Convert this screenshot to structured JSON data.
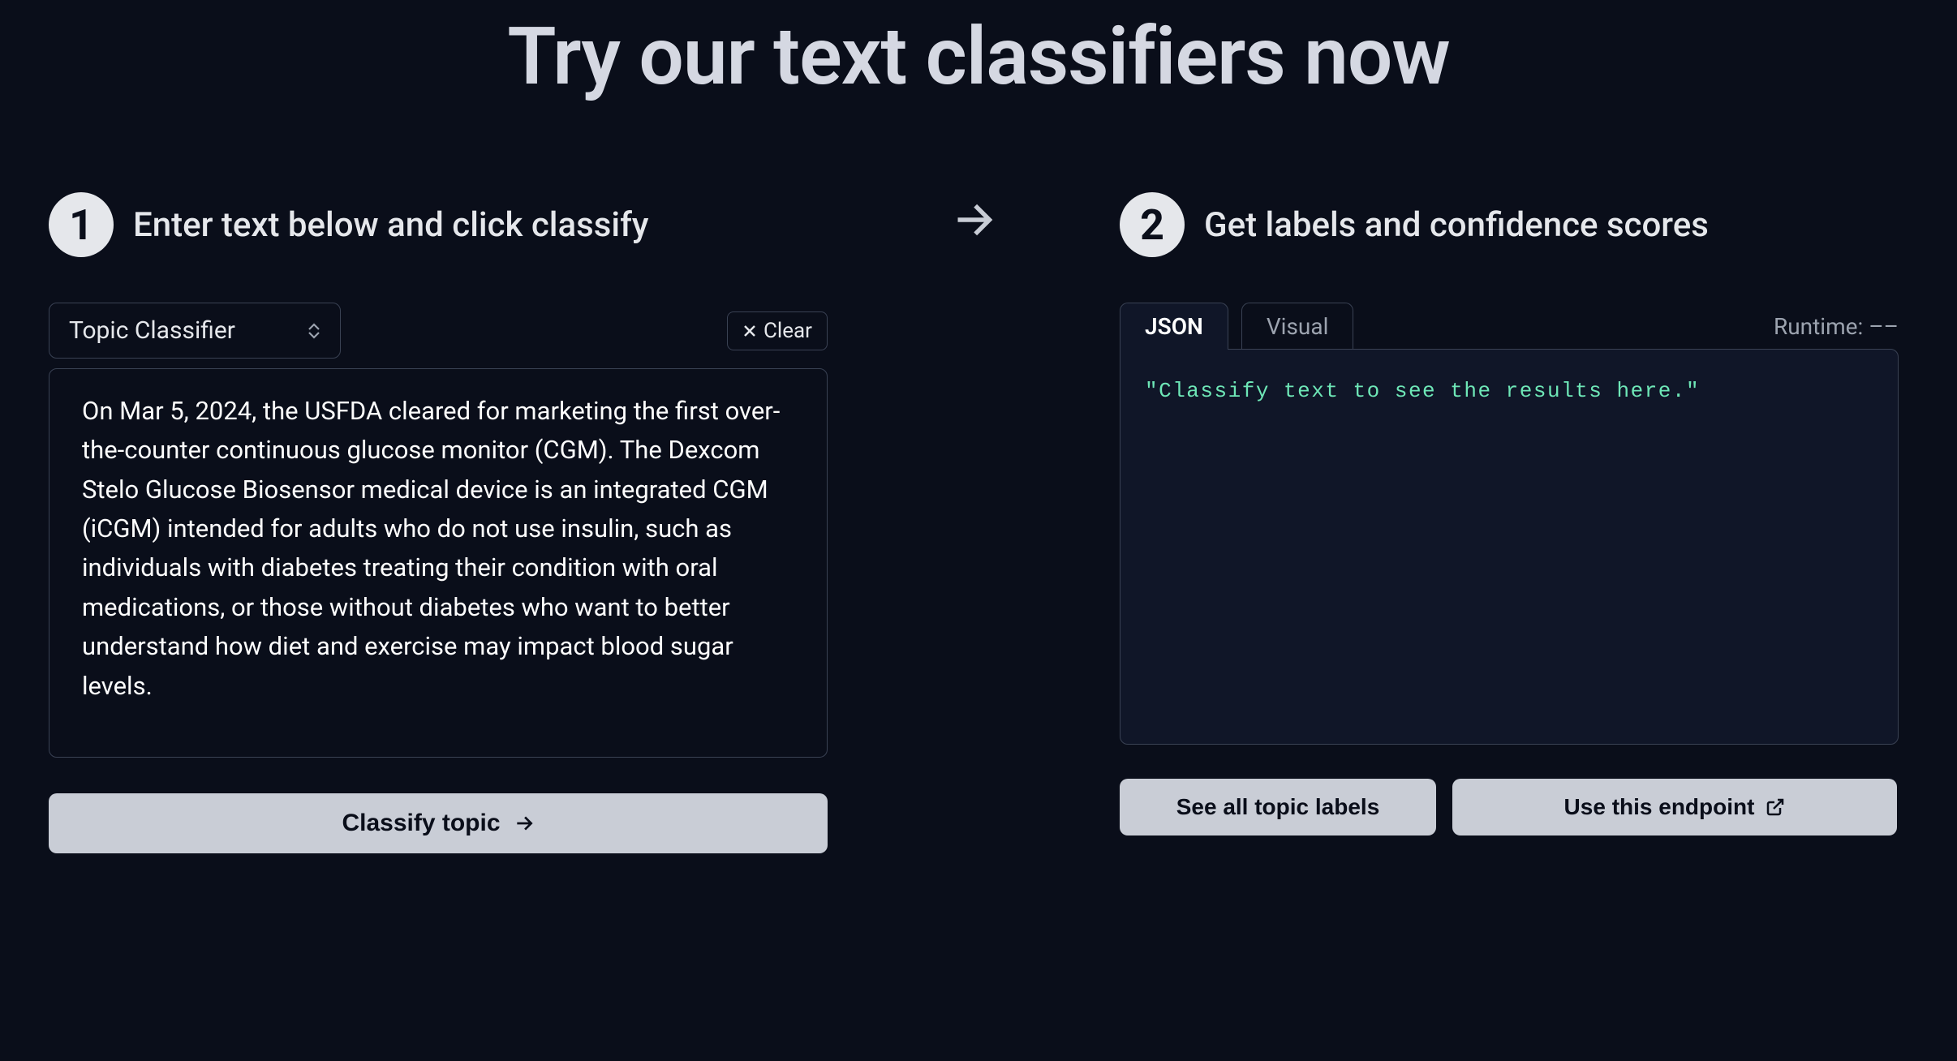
{
  "title": "Try our text classifiers now",
  "steps": {
    "one": {
      "num": "1",
      "title": "Enter text below and click classify"
    },
    "two": {
      "num": "2",
      "title": "Get labels and confidence scores"
    }
  },
  "left": {
    "classifier_select": "Topic Classifier",
    "clear_label": "Clear",
    "text_value": "On Mar 5, 2024, the USFDA cleared for marketing the first over-the-counter continuous glucose monitor (CGM). The Dexcom Stelo Glucose Biosensor medical device is an integrated CGM (iCGM) intended for adults who do not use insulin, such as individuals with diabetes treating their condition with oral medications, or those without diabetes who want to better understand how diet and exercise may impact blood sugar levels.",
    "classify_label": "Classify topic"
  },
  "right": {
    "tabs": {
      "json": "JSON",
      "visual": "Visual"
    },
    "runtime_label": "Runtime:",
    "runtime_value": "––",
    "output_placeholder": "\"Classify text to see the results here.\"",
    "see_labels_label": "See all topic labels",
    "use_endpoint_label": "Use this endpoint"
  }
}
